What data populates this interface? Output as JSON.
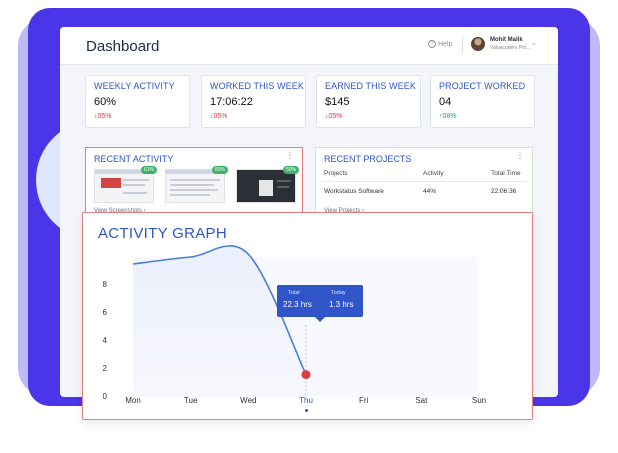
{
  "header": {
    "title": "Dashboard",
    "help_label": "Help",
    "user_name": "Mohit Malik",
    "user_org": "Valuecoders Pvt..."
  },
  "stats": [
    {
      "label": "WEEKLY ACTIVITY",
      "value": "60%",
      "change": "05%",
      "direction": "down"
    },
    {
      "label": "WORKED THIS WEEK",
      "value": "17:06:22",
      "change": "05%",
      "direction": "down"
    },
    {
      "label": "EARNED THIS WEEK",
      "value": "$145",
      "change": "05%",
      "direction": "down"
    },
    {
      "label": "PROJECT WORKED",
      "value": "04",
      "change": "08%",
      "direction": "up"
    }
  ],
  "recent_activity": {
    "title": "RECENT ACTIVITY",
    "screenshots": [
      {
        "percent": "61%"
      },
      {
        "percent": "80%"
      },
      {
        "percent": "50%"
      }
    ],
    "link": "View Screenshots"
  },
  "recent_projects": {
    "title": "RECENT PROJECTS",
    "columns": [
      "Projects",
      "Activity",
      "Total Time"
    ],
    "rows": [
      [
        "Workstatus Software",
        "44%",
        "22:06:36"
      ]
    ],
    "link": "View Projects"
  },
  "activity_graph": {
    "title": "ACTIVITY GRAPH",
    "tooltip": {
      "label_a": "Total",
      "value_a": "22.3 hrs",
      "label_b": "Today",
      "value_b": "1.3 hrs"
    }
  },
  "chart_data": {
    "type": "area",
    "title": "ACTIVITY GRAPH",
    "categories": [
      "Mon",
      "Tue",
      "Wed",
      "Thu",
      "Fri",
      "Sat",
      "Sun"
    ],
    "y_ticks": [
      0,
      2,
      4,
      6,
      8
    ],
    "ylim": [
      0,
      10
    ],
    "series": [
      {
        "values": [
          9.5,
          10.0,
          10.2,
          1.6,
          null,
          null,
          null
        ]
      }
    ],
    "highlight_category": "Thu",
    "colors": {
      "line": "#4a7fd6",
      "fill": "#eef1fb",
      "marker": "#e0393e",
      "accent": "#2f55c8"
    },
    "grid": false
  }
}
